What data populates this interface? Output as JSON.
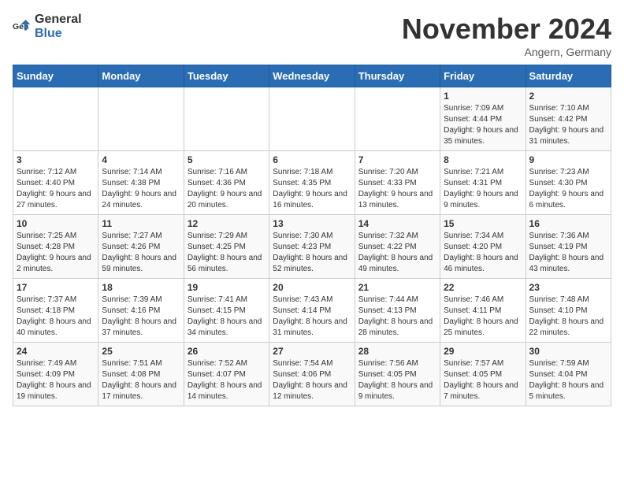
{
  "logo": {
    "general": "General",
    "blue": "Blue"
  },
  "title": "November 2024",
  "location": "Angern, Germany",
  "days_header": [
    "Sunday",
    "Monday",
    "Tuesday",
    "Wednesday",
    "Thursday",
    "Friday",
    "Saturday"
  ],
  "weeks": [
    [
      {
        "day": "",
        "info": ""
      },
      {
        "day": "",
        "info": ""
      },
      {
        "day": "",
        "info": ""
      },
      {
        "day": "",
        "info": ""
      },
      {
        "day": "",
        "info": ""
      },
      {
        "day": "1",
        "info": "Sunrise: 7:09 AM\nSunset: 4:44 PM\nDaylight: 9 hours and 35 minutes."
      },
      {
        "day": "2",
        "info": "Sunrise: 7:10 AM\nSunset: 4:42 PM\nDaylight: 9 hours and 31 minutes."
      }
    ],
    [
      {
        "day": "3",
        "info": "Sunrise: 7:12 AM\nSunset: 4:40 PM\nDaylight: 9 hours and 27 minutes."
      },
      {
        "day": "4",
        "info": "Sunrise: 7:14 AM\nSunset: 4:38 PM\nDaylight: 9 hours and 24 minutes."
      },
      {
        "day": "5",
        "info": "Sunrise: 7:16 AM\nSunset: 4:36 PM\nDaylight: 9 hours and 20 minutes."
      },
      {
        "day": "6",
        "info": "Sunrise: 7:18 AM\nSunset: 4:35 PM\nDaylight: 9 hours and 16 minutes."
      },
      {
        "day": "7",
        "info": "Sunrise: 7:20 AM\nSunset: 4:33 PM\nDaylight: 9 hours and 13 minutes."
      },
      {
        "day": "8",
        "info": "Sunrise: 7:21 AM\nSunset: 4:31 PM\nDaylight: 9 hours and 9 minutes."
      },
      {
        "day": "9",
        "info": "Sunrise: 7:23 AM\nSunset: 4:30 PM\nDaylight: 9 hours and 6 minutes."
      }
    ],
    [
      {
        "day": "10",
        "info": "Sunrise: 7:25 AM\nSunset: 4:28 PM\nDaylight: 9 hours and 2 minutes."
      },
      {
        "day": "11",
        "info": "Sunrise: 7:27 AM\nSunset: 4:26 PM\nDaylight: 8 hours and 59 minutes."
      },
      {
        "day": "12",
        "info": "Sunrise: 7:29 AM\nSunset: 4:25 PM\nDaylight: 8 hours and 56 minutes."
      },
      {
        "day": "13",
        "info": "Sunrise: 7:30 AM\nSunset: 4:23 PM\nDaylight: 8 hours and 52 minutes."
      },
      {
        "day": "14",
        "info": "Sunrise: 7:32 AM\nSunset: 4:22 PM\nDaylight: 8 hours and 49 minutes."
      },
      {
        "day": "15",
        "info": "Sunrise: 7:34 AM\nSunset: 4:20 PM\nDaylight: 8 hours and 46 minutes."
      },
      {
        "day": "16",
        "info": "Sunrise: 7:36 AM\nSunset: 4:19 PM\nDaylight: 8 hours and 43 minutes."
      }
    ],
    [
      {
        "day": "17",
        "info": "Sunrise: 7:37 AM\nSunset: 4:18 PM\nDaylight: 8 hours and 40 minutes."
      },
      {
        "day": "18",
        "info": "Sunrise: 7:39 AM\nSunset: 4:16 PM\nDaylight: 8 hours and 37 minutes."
      },
      {
        "day": "19",
        "info": "Sunrise: 7:41 AM\nSunset: 4:15 PM\nDaylight: 8 hours and 34 minutes."
      },
      {
        "day": "20",
        "info": "Sunrise: 7:43 AM\nSunset: 4:14 PM\nDaylight: 8 hours and 31 minutes."
      },
      {
        "day": "21",
        "info": "Sunrise: 7:44 AM\nSunset: 4:13 PM\nDaylight: 8 hours and 28 minutes."
      },
      {
        "day": "22",
        "info": "Sunrise: 7:46 AM\nSunset: 4:11 PM\nDaylight: 8 hours and 25 minutes."
      },
      {
        "day": "23",
        "info": "Sunrise: 7:48 AM\nSunset: 4:10 PM\nDaylight: 8 hours and 22 minutes."
      }
    ],
    [
      {
        "day": "24",
        "info": "Sunrise: 7:49 AM\nSunset: 4:09 PM\nDaylight: 8 hours and 19 minutes."
      },
      {
        "day": "25",
        "info": "Sunrise: 7:51 AM\nSunset: 4:08 PM\nDaylight: 8 hours and 17 minutes."
      },
      {
        "day": "26",
        "info": "Sunrise: 7:52 AM\nSunset: 4:07 PM\nDaylight: 8 hours and 14 minutes."
      },
      {
        "day": "27",
        "info": "Sunrise: 7:54 AM\nSunset: 4:06 PM\nDaylight: 8 hours and 12 minutes."
      },
      {
        "day": "28",
        "info": "Sunrise: 7:56 AM\nSunset: 4:05 PM\nDaylight: 8 hours and 9 minutes."
      },
      {
        "day": "29",
        "info": "Sunrise: 7:57 AM\nSunset: 4:05 PM\nDaylight: 8 hours and 7 minutes."
      },
      {
        "day": "30",
        "info": "Sunrise: 7:59 AM\nSunset: 4:04 PM\nDaylight: 8 hours and 5 minutes."
      }
    ]
  ]
}
